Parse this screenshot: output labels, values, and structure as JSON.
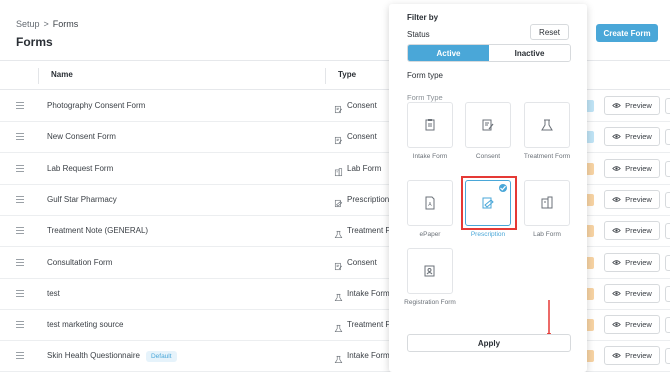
{
  "breadcrumb": {
    "root": "Setup",
    "separator": ">",
    "current": "Forms"
  },
  "page_title": "Forms",
  "create_button": "Create Form",
  "table": {
    "headers": {
      "name": "Name",
      "type": "Type"
    },
    "rows": [
      {
        "name": "Photography Consent Form",
        "type": "Consent",
        "icon": "consent-icon",
        "badge": "",
        "tag_color": "#bfe3f5"
      },
      {
        "name": "New Consent Form",
        "type": "Consent",
        "icon": "consent-icon",
        "badge": "",
        "tag_color": "#bfe3f5"
      },
      {
        "name": "Lab Request Form",
        "type": "Lab Form",
        "icon": "lab-form-icon",
        "badge": "",
        "tag_color": "#f7d3a3"
      },
      {
        "name": "Gulf Star Pharmacy",
        "type": "Prescription",
        "icon": "prescription-icon",
        "badge": "",
        "tag_color": "#f7d3a3"
      },
      {
        "name": "Treatment Note (GENERAL)",
        "type": "Treatment Form",
        "icon": "treatment-icon",
        "badge": "",
        "tag_color": "#f7d3a3"
      },
      {
        "name": "Consultation Form",
        "type": "Consent",
        "icon": "consent-icon",
        "badge": "",
        "tag_color": "#f7d3a3"
      },
      {
        "name": "test",
        "type": "Intake Form",
        "icon": "treatment-icon",
        "badge": "",
        "tag_color": "#f7d3a3"
      },
      {
        "name": "test marketing source",
        "type": "Treatment Form",
        "icon": "treatment-icon",
        "badge": "",
        "tag_color": "#f7d3a3"
      },
      {
        "name": "Skin Health Questionnaire",
        "type": "Intake Form",
        "icon": "treatment-icon",
        "badge": "Default",
        "tag_color": "#f7d3a3"
      }
    ],
    "preview_label": "Preview"
  },
  "filter": {
    "heading": "Filter by",
    "reset_label": "Reset",
    "status_label": "Status",
    "status_options": [
      "Active",
      "Inactive"
    ],
    "status_selected": "Active",
    "form_type_label": "Form type",
    "form_type_sublabel": "Form Type",
    "types": [
      {
        "label": "Intake Form",
        "icon": "intake-form-icon",
        "selected": false
      },
      {
        "label": "Consent",
        "icon": "consent-icon",
        "selected": false
      },
      {
        "label": "Treatment Form",
        "icon": "treatment-icon",
        "selected": false
      },
      {
        "label": "ePaper",
        "icon": "epaper-icon",
        "selected": false
      },
      {
        "label": "Prescription",
        "icon": "prescription-icon",
        "selected": true
      },
      {
        "label": "Lab Form",
        "icon": "lab-form-icon",
        "selected": false
      },
      {
        "label": "Registration Form",
        "icon": "registration-form-icon",
        "selected": false
      }
    ],
    "apply_label": "Apply"
  },
  "colors": {
    "accent": "#4aa7d8",
    "highlight_box": "#e53935",
    "arrow": "#e53935"
  }
}
